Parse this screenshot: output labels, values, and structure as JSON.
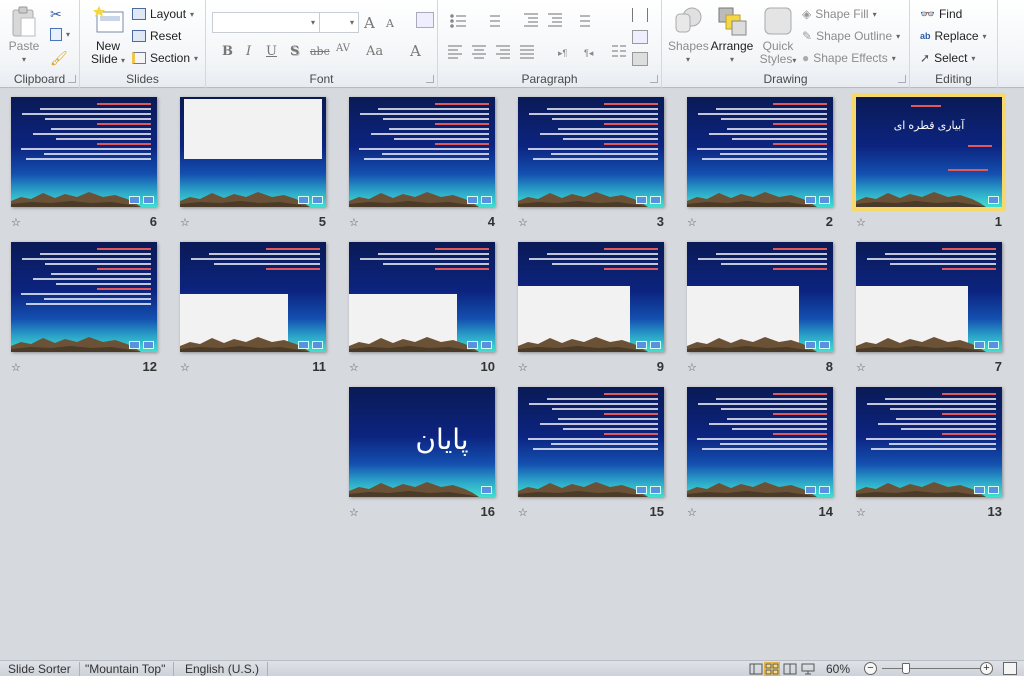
{
  "ribbon": {
    "clipboard": {
      "label": "Clipboard",
      "paste": "Paste"
    },
    "slides": {
      "label": "Slides",
      "new_slide_line1": "New",
      "new_slide_line2": "Slide",
      "layout": "Layout",
      "reset": "Reset",
      "section": "Section"
    },
    "font": {
      "label": "Font",
      "font_name": "",
      "font_size": "",
      "bold": "B",
      "italic": "I",
      "underline": "U",
      "shadow": "S",
      "strike": "abc",
      "spacing": "AV",
      "case": "Aa",
      "color": "A",
      "grow": "A",
      "shrink": "A"
    },
    "paragraph": {
      "label": "Paragraph"
    },
    "drawing": {
      "label": "Drawing",
      "shapes": "Shapes",
      "arrange": "Arrange",
      "quick_styles_line1": "Quick",
      "quick_styles_line2": "Styles",
      "shape_fill": "Shape Fill",
      "shape_outline": "Shape Outline",
      "shape_effects": "Shape Effects"
    },
    "editing": {
      "label": "Editing",
      "find": "Find",
      "replace": "Replace",
      "select": "Select"
    }
  },
  "slides": [
    {
      "number": "1",
      "title": "آبیاری قطره ای",
      "selected": true,
      "kind": "title"
    },
    {
      "number": "2",
      "kind": "text"
    },
    {
      "number": "3",
      "kind": "text"
    },
    {
      "number": "4",
      "kind": "text"
    },
    {
      "number": "5",
      "kind": "image-top"
    },
    {
      "number": "6",
      "kind": "text"
    },
    {
      "number": "7",
      "kind": "image-bottom"
    },
    {
      "number": "8",
      "kind": "image-bottom"
    },
    {
      "number": "9",
      "kind": "image-bottom"
    },
    {
      "number": "10",
      "kind": "image-left"
    },
    {
      "number": "11",
      "kind": "image-left"
    },
    {
      "number": "12",
      "kind": "text"
    },
    {
      "number": "13",
      "kind": "text"
    },
    {
      "number": "14",
      "kind": "text"
    },
    {
      "number": "15",
      "kind": "text"
    },
    {
      "number": "16",
      "title": "پایان",
      "kind": "end"
    }
  ],
  "statusbar": {
    "view": "Slide Sorter",
    "theme": "\"Mountain Top\"",
    "language": "English (U.S.)",
    "zoom": "60%",
    "zoom_minus": "−",
    "zoom_plus": "+"
  },
  "colors": {
    "selection": "#f7d86a",
    "slide_bg": "#0c2480"
  }
}
